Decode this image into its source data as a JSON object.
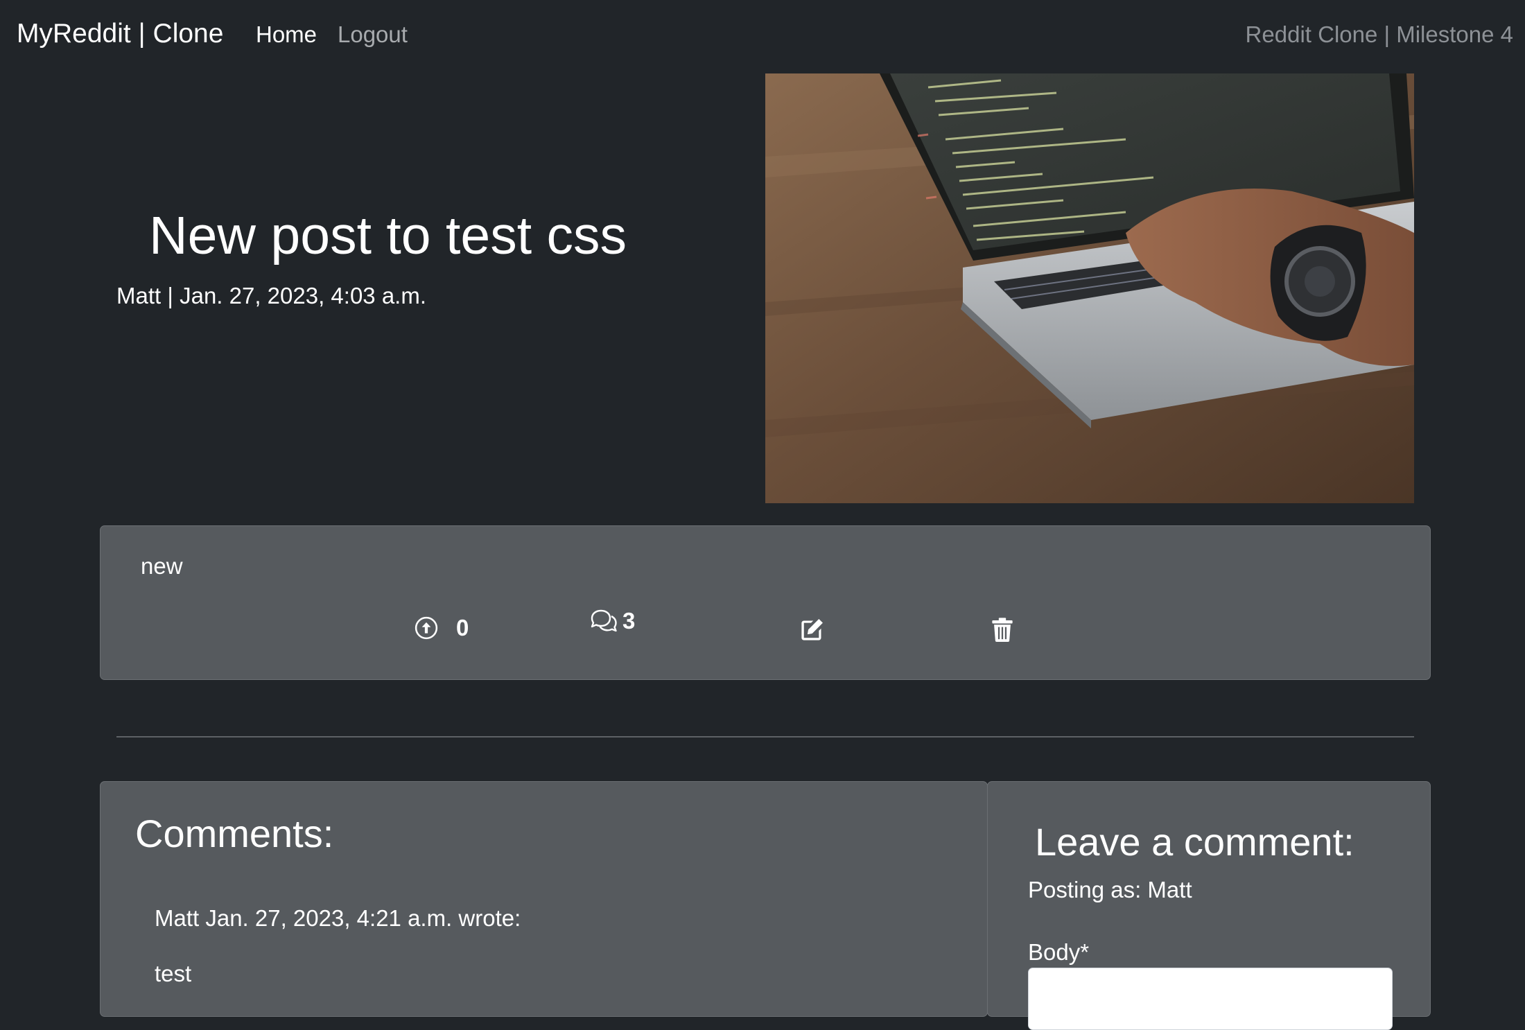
{
  "navbar": {
    "brand": "MyReddit | Clone",
    "links": [
      {
        "label": "Home"
      },
      {
        "label": "Logout"
      }
    ],
    "right_text": "Reddit Clone | Milestone 4"
  },
  "post": {
    "title": "New post to test css",
    "meta": "Matt | Jan. 27, 2023, 4:03 a.m.",
    "image_icon": "laptop-coding-photo",
    "body": "new",
    "upvotes": "0",
    "comment_count": "3",
    "icons": {
      "upvote": "arrow-up-circle-icon",
      "comments": "chat-bubbles-icon",
      "edit": "pencil-square-icon",
      "delete": "trash-icon"
    }
  },
  "comments": {
    "heading": "Comments:",
    "items": [
      {
        "header": "Matt Jan. 27, 2023, 4:21 a.m. wrote:",
        "body": "test"
      }
    ]
  },
  "comment_form": {
    "heading": "Leave a comment:",
    "posting_as": "Posting as: Matt",
    "body_label": "Body*",
    "body_value": ""
  },
  "colors": {
    "page_bg": "#212529",
    "card_bg": "#565a5e",
    "text": "#ffffff",
    "muted_text": "#8d9196"
  }
}
